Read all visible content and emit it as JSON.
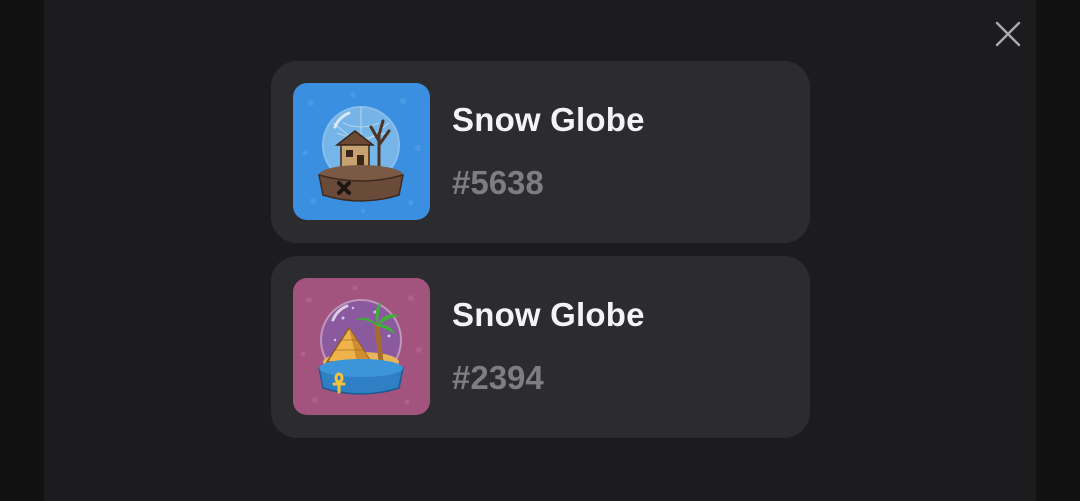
{
  "dialog": {
    "close_icon": "close-icon",
    "items": [
      {
        "title": "Snow Globe",
        "id": "#5638",
        "image": "snow-globe-haunted-house",
        "bg_color": "#3b8fe0"
      },
      {
        "title": "Snow Globe",
        "id": "#2394",
        "image": "snow-globe-pyramid",
        "bg_color": "#a2547f"
      }
    ]
  }
}
